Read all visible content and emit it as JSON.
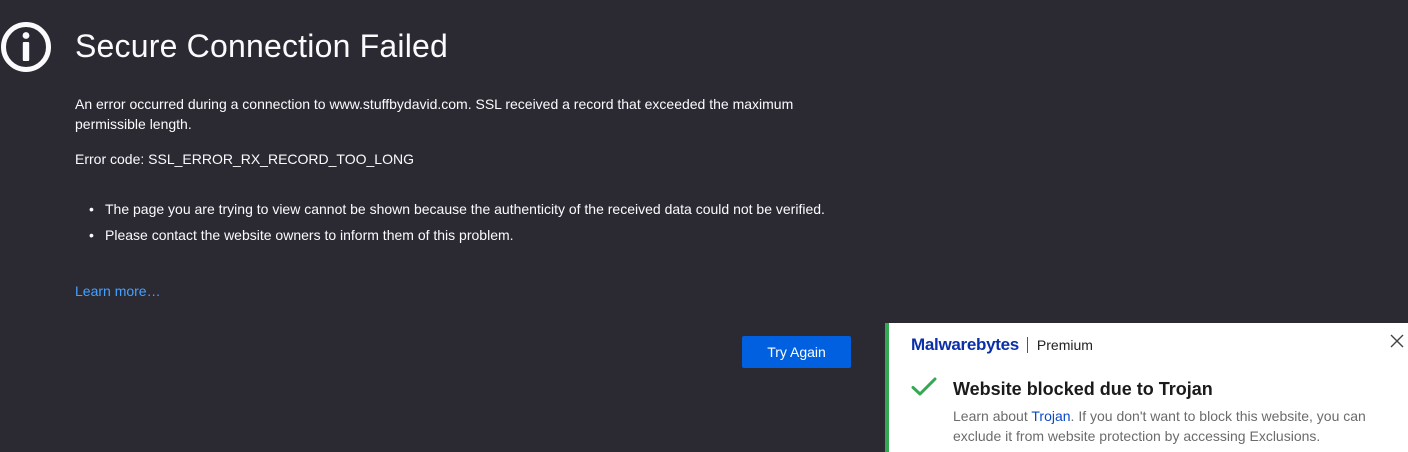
{
  "error_page": {
    "title": "Secure Connection Failed",
    "description": "An error occurred during a connection to www.stuffbydavid.com. SSL received a record that exceeded the maximum permissible length.",
    "error_code_label": "Error code: ",
    "error_code": "SSL_ERROR_RX_RECORD_TOO_LONG",
    "bullets": [
      "The page you are trying to view cannot be shown because the authenticity of the received data could not be verified.",
      "Please contact the website owners to inform them of this problem."
    ],
    "learn_more": "Learn more…",
    "try_again": "Try Again",
    "icon": "info-icon"
  },
  "toast": {
    "brand": "Malwarebytes",
    "tier": "Premium",
    "title": "Website blocked due to Trojan",
    "body_prefix": "Learn about ",
    "body_link": "Trojan",
    "body_suffix": ". If you don't want to block this website, you can exclude it from website protection by accessing Exclusions.",
    "close_icon": "close-icon",
    "status_icon": "checkmark-icon",
    "accent_color": "#34a853"
  },
  "colors": {
    "background": "#2b2a33",
    "primary_button": "#0060df",
    "link": "#45a1ff",
    "brand_blue": "#0a2fa8"
  }
}
